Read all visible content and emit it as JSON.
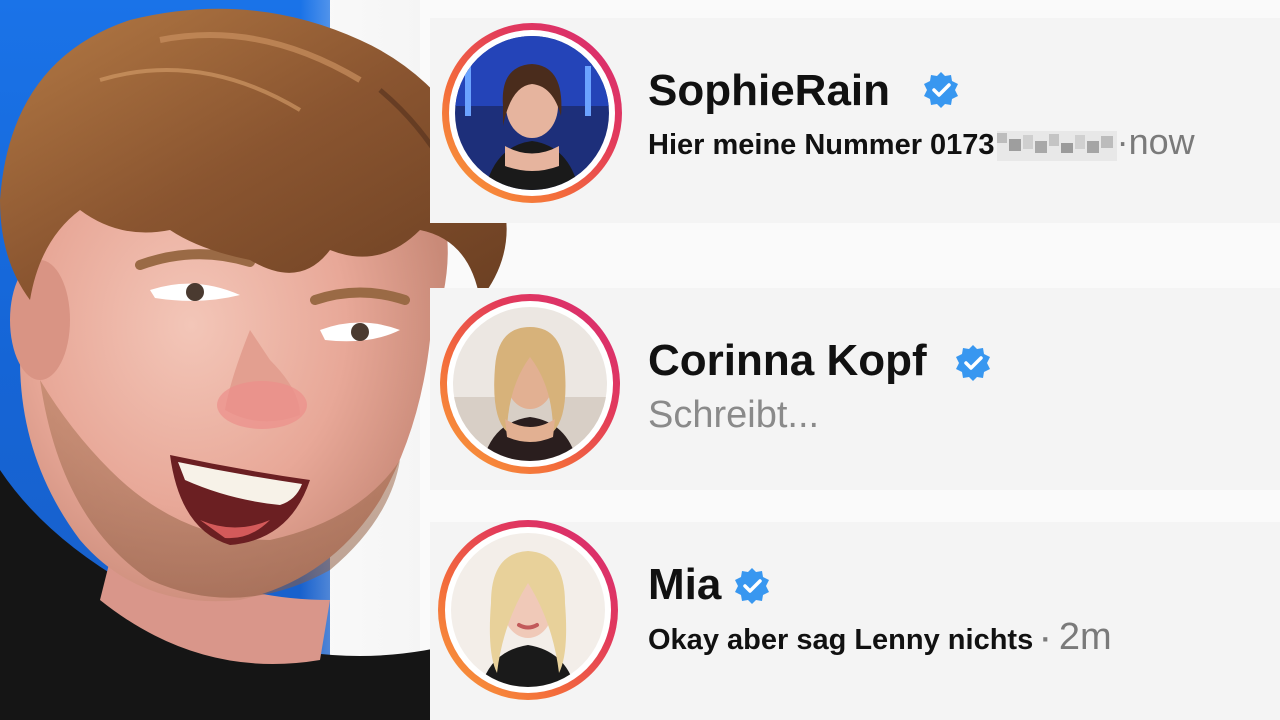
{
  "chats": [
    {
      "name": "SophieRain",
      "verified": true,
      "message": "Hier meine Nummer 0173",
      "message_redacted": true,
      "time": "now"
    },
    {
      "name": "Corinna Kopf",
      "verified": true,
      "status": "Schreibt..."
    },
    {
      "name": "Mia",
      "verified": true,
      "message": "Okay aber sag Lenny nichts",
      "separator": "·",
      "time": "2m"
    }
  ],
  "colors": {
    "verified_badge": "#3897f0",
    "ring_gradient": [
      "#f9a13a",
      "#e23a5b",
      "#d62976"
    ],
    "background_left": "#1a73e8",
    "card_bg": "#f4f4f4"
  },
  "icons": [
    "verified-badge-icon"
  ]
}
